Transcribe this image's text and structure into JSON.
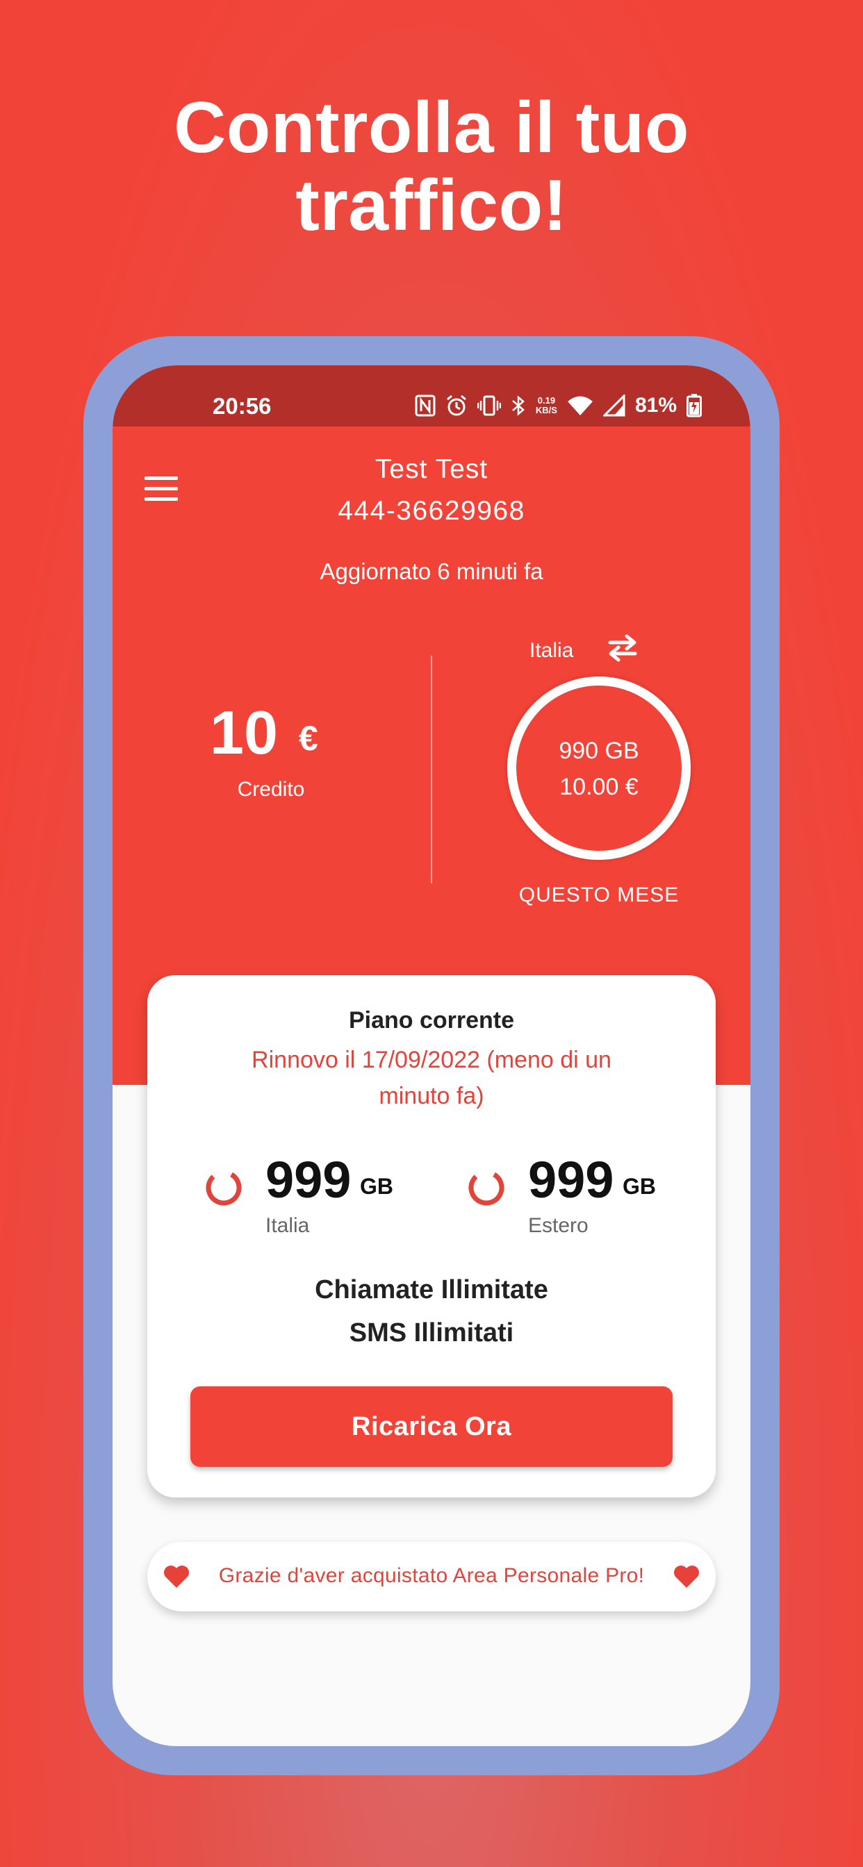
{
  "headline": {
    "line1": "Controlla il tuo",
    "line2": "traffico!"
  },
  "status_bar": {
    "time": "20:56",
    "speed_value": "0.19",
    "speed_unit": "KB/S",
    "battery": "81%"
  },
  "header": {
    "user_name": "Test Test",
    "user_number": "444-36629968",
    "updated": "Aggiornato 6 minuti fa",
    "credit_value": "10",
    "credit_currency": "€",
    "credit_label": "Credito",
    "region": "Italia",
    "ring_data": "990 GB",
    "ring_cost": "10.00 €",
    "period": "QUESTO MESE",
    "ring_fill": 1.0
  },
  "plan": {
    "title": "Piano corrente",
    "renewal": "Rinnovo il 17/09/2022 (meno di un minuto fa)",
    "quotas": [
      {
        "value": "999",
        "unit": "GB",
        "label": "Italia"
      },
      {
        "value": "999",
        "unit": "GB",
        "label": "Estero"
      }
    ],
    "calls": "Chiamate Illimitate",
    "sms": "SMS Illimitati",
    "button": "Ricarica Ora"
  },
  "thanks": {
    "text": "Grazie d'aver acquistato Area Personale Pro!"
  },
  "colors": {
    "accent": "#f24338",
    "status_bar": "#b32f29",
    "frame": "#8c9fd6"
  },
  "icons": [
    "menu-icon",
    "swap-icon",
    "nfc-icon",
    "alarm-icon",
    "vibrate-icon",
    "bluetooth-icon",
    "wifi-icon",
    "signal-icon",
    "battery-icon",
    "ring-progress-icon",
    "heart-icon"
  ]
}
